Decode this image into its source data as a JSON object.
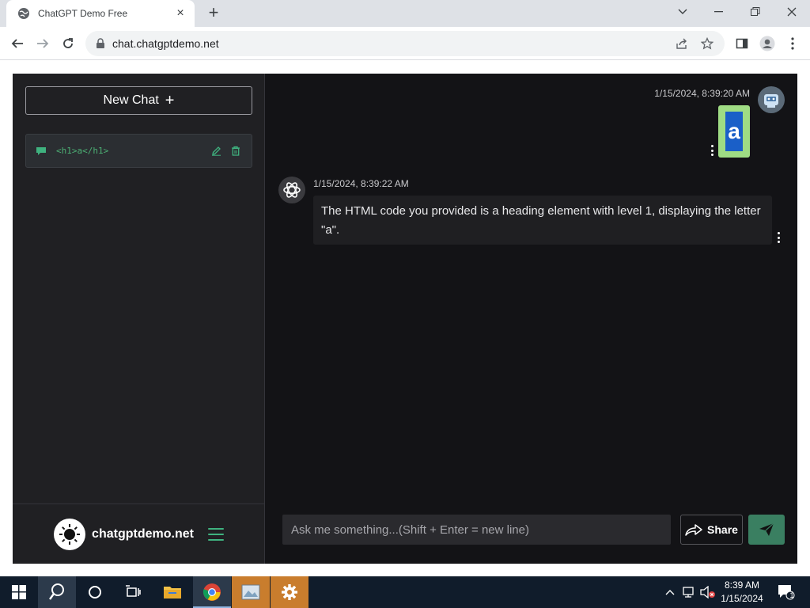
{
  "browser": {
    "tab_title": "ChatGPT Demo Free",
    "new_tab": "+",
    "url": "chat.chatgptdemo.net"
  },
  "sidebar": {
    "new_chat_label": "New Chat",
    "new_chat_icon": "+",
    "chats": [
      {
        "title": "<h1>a</h1>"
      }
    ],
    "brand": "chatgptdemo.net"
  },
  "messages": [
    {
      "role": "user",
      "time": "1/15/2024, 8:39:20 AM",
      "text": "a"
    },
    {
      "role": "assistant",
      "time": "1/15/2024, 8:39:22 AM",
      "text": "The HTML code you provided is a heading element with level 1, displaying the letter \"a\"."
    }
  ],
  "composer": {
    "placeholder": "Ask me something...(Shift + Enter = new line)",
    "share_label": "Share"
  },
  "taskbar": {
    "time": "8:39 AM",
    "date": "1/15/2024",
    "notifications": "1"
  },
  "colors": {
    "accent": "#3fb27f",
    "chat_title": "#4caf74",
    "user_bubble": "#9fdc84",
    "send_button": "#3a7f61"
  }
}
